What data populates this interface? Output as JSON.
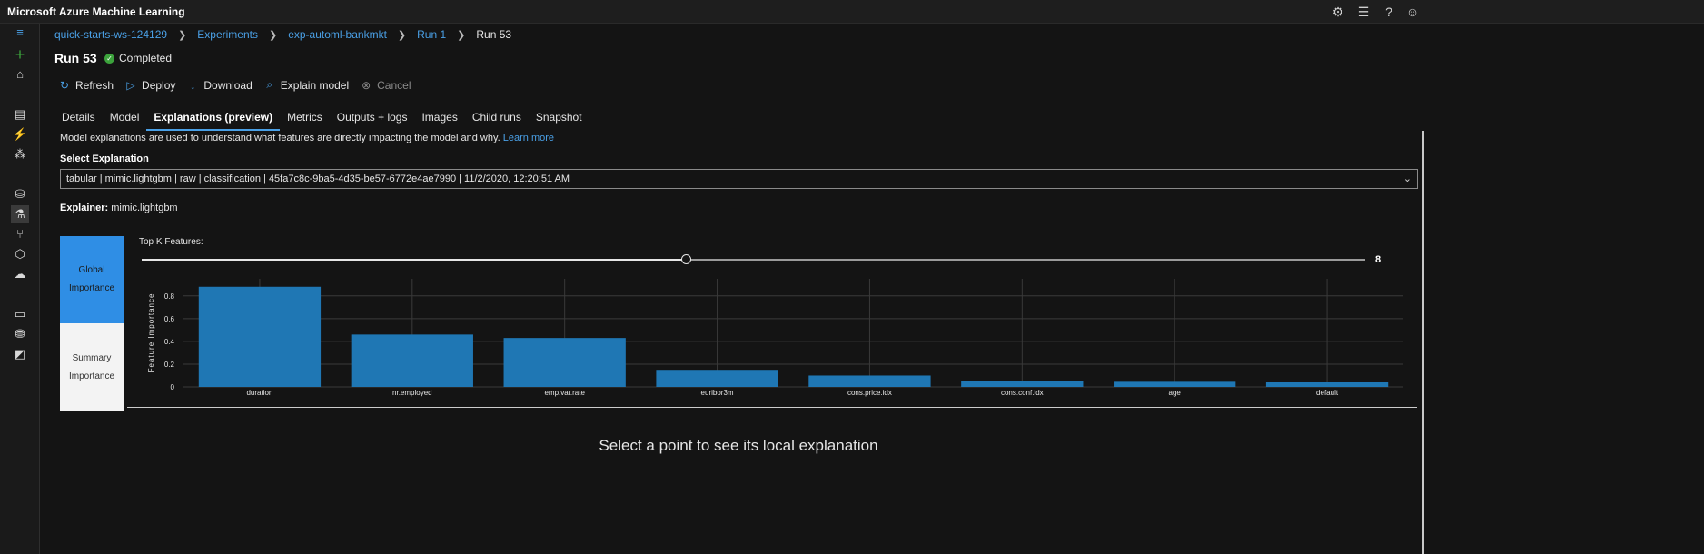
{
  "app": {
    "title": "Microsoft Azure Machine Learning"
  },
  "topbar_icons": [
    "settings-icon",
    "feedback-icon",
    "help-icon",
    "smiley-icon"
  ],
  "rail_icons": [
    "hamburger-icon",
    "plus-icon",
    "home-icon",
    "notebook-icon",
    "automl-icon",
    "designer-icon",
    "datasets-icon",
    "experiments-icon",
    "pipelines-icon",
    "models-icon",
    "endpoints-icon",
    "compute-icon",
    "datastores-icon",
    "labeling-icon"
  ],
  "breadcrumb": {
    "workspace": "quick-starts-ws-124129",
    "experiments": "Experiments",
    "experiment": "exp-automl-bankmkt",
    "parent_run": "Run 1",
    "current": "Run 53"
  },
  "run": {
    "title": "Run 53",
    "status": "Completed",
    "status_color": "#3ca33c"
  },
  "toolbar": {
    "refresh": "Refresh",
    "deploy": "Deploy",
    "download": "Download",
    "explain": "Explain model",
    "cancel": "Cancel"
  },
  "tabs": [
    "Details",
    "Model",
    "Explanations (preview)",
    "Metrics",
    "Outputs + logs",
    "Images",
    "Child runs",
    "Snapshot"
  ],
  "active_tab": "Explanations (preview)",
  "description": {
    "text": "Model explanations are used to understand what features are directly impacting the model and why.",
    "link": "Learn more"
  },
  "select_explanation": {
    "label": "Select Explanation",
    "value": "tabular | mimic.lightgbm | raw | classification | 45fa7c8c-9ba5-4d35-be57-6772e4ae7990 | 11/2/2020, 12:20:51 AM"
  },
  "explainer": {
    "label": "Explainer:",
    "value": "mimic.lightgbm"
  },
  "importance_tabs": {
    "global": "Global Importance",
    "summary": "Summary Importance"
  },
  "top_k": {
    "label": "Top K Features:",
    "value": 8,
    "max": 18,
    "value_label": "8"
  },
  "chart_data": {
    "type": "bar",
    "categories": [
      "duration",
      "nr.employed",
      "emp.var.rate",
      "euribor3m",
      "cons.price.idx",
      "cons.conf.idx",
      "age",
      "default"
    ],
    "values": [
      0.88,
      0.46,
      0.43,
      0.15,
      0.1,
      0.055,
      0.045,
      0.04
    ],
    "ylabel": "Feature Importance",
    "xlabel": "",
    "ylim": [
      0,
      0.95
    ],
    "yticks": [
      0,
      0.2,
      0.4,
      0.6,
      0.8
    ],
    "ytick_labels": [
      "0",
      "0.2",
      "0.4",
      "0.6",
      "0.8"
    ],
    "bar_color": "#1f77b4",
    "grid": true
  },
  "local_message": "Select a point to see its local explanation",
  "colors": {
    "accent": "#4aa0e6",
    "global_active": "#2f8ee5"
  }
}
